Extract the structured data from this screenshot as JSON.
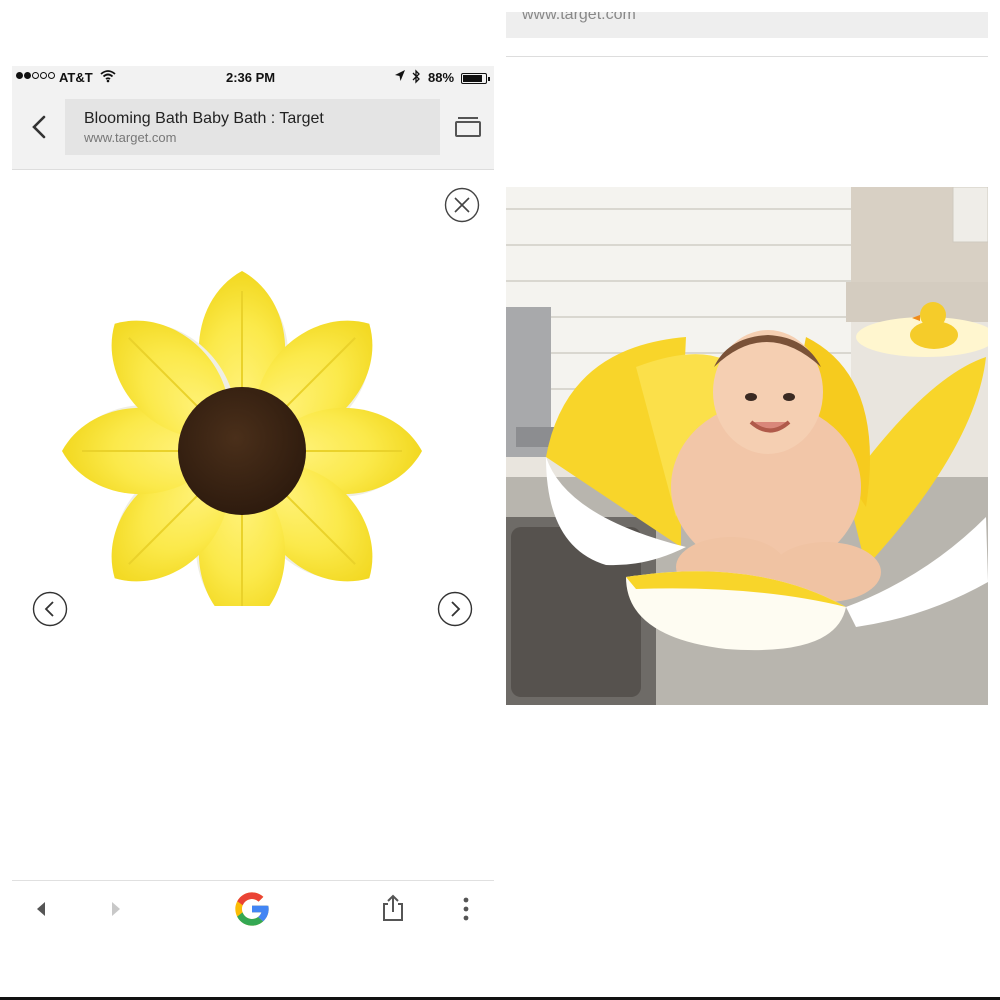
{
  "status_bar": {
    "carrier": "AT&T",
    "time": "2:36 PM",
    "battery_percent": "88%",
    "battery_level": 0.88,
    "signal_bars": 2,
    "icons": [
      "wifi-icon",
      "location-icon",
      "bluetooth-icon",
      "battery-icon"
    ]
  },
  "browser": {
    "page_title": "Blooming Bath Baby Bath : Target",
    "page_url": "www.target.com"
  },
  "viewer": {
    "icons": [
      "close-icon",
      "chevron-left-icon",
      "chevron-right-icon"
    ]
  },
  "toolbar": {
    "icons": [
      "back-arrow-icon",
      "forward-arrow-icon",
      "google-logo",
      "share-icon",
      "more-vert-icon"
    ],
    "google_colors": [
      "#4285F4",
      "#EA4335",
      "#FBBC05",
      "#34A853"
    ]
  },
  "right_panel": {
    "url_text": "www.target.com"
  },
  "colors": {
    "petal": "#FBE94A",
    "center": "#3B2413",
    "chrome_bg": "#f2f2f2"
  }
}
